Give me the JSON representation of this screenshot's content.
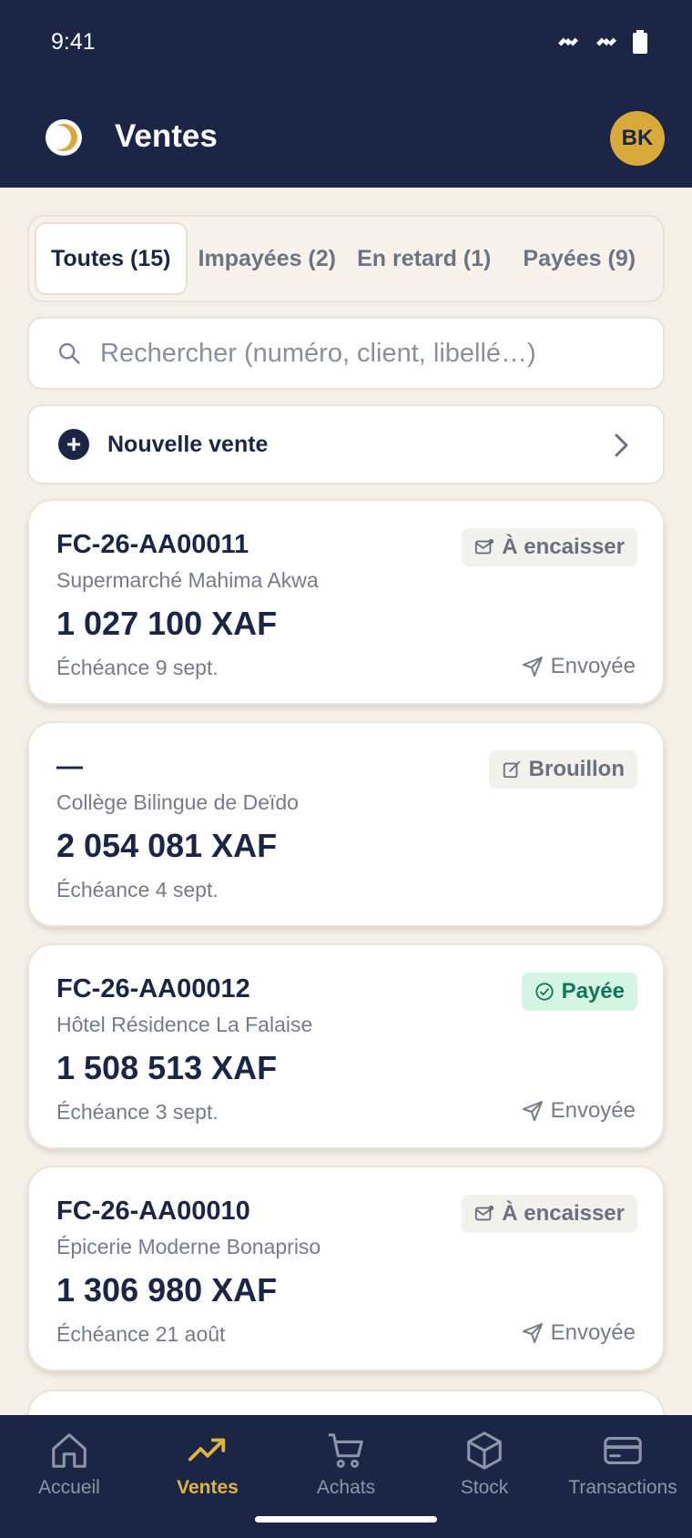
{
  "status": {
    "time": "9:41"
  },
  "header": {
    "title": "Ventes",
    "avatar_initials": "BK"
  },
  "tabs": [
    {
      "label": "Toutes (15)",
      "active": true
    },
    {
      "label": "Impayées (2)",
      "active": false
    },
    {
      "label": "En retard (1)",
      "active": false
    },
    {
      "label": "Payées (9)",
      "active": false
    }
  ],
  "search": {
    "placeholder": "Rechercher (numéro, client, libellé…)"
  },
  "new_sale": {
    "label": "Nouvelle vente"
  },
  "invoices": [
    {
      "number": "FC-26-AA00011",
      "client": "Supermarché Mahima Akwa",
      "amount": "1 027 100 XAF",
      "due": "Échéance 9 sept.",
      "status": "À encaisser",
      "sent": "Envoyée"
    },
    {
      "number": "—",
      "client": "Collège Bilingue de Deïdo",
      "amount": "2 054 081 XAF",
      "due": "Échéance 4 sept.",
      "status": "Brouillon",
      "sent": ""
    },
    {
      "number": "FC-26-AA00012",
      "client": "Hôtel Résidence La Falaise",
      "amount": "1 508 513 XAF",
      "due": "Échéance 3 sept.",
      "status": "Payée",
      "sent": "Envoyée"
    },
    {
      "number": "FC-26-AA00010",
      "client": "Épicerie Moderne Bonapriso",
      "amount": "1 306 980 XAF",
      "due": "Échéance 21 août",
      "status": "À encaisser",
      "sent": "Envoyée"
    }
  ],
  "nav": [
    {
      "label": "Accueil",
      "icon": "home-icon",
      "active": false
    },
    {
      "label": "Ventes",
      "icon": "trending-up-icon",
      "active": true
    },
    {
      "label": "Achats",
      "icon": "cart-icon",
      "active": false
    },
    {
      "label": "Stock",
      "icon": "box-icon",
      "active": false
    },
    {
      "label": "Transactions",
      "icon": "card-icon",
      "active": false
    }
  ],
  "colors": {
    "navy": "#1b2646",
    "gold": "#d9a93a",
    "paid_green": "#10785a",
    "background": "#f4efe7"
  }
}
